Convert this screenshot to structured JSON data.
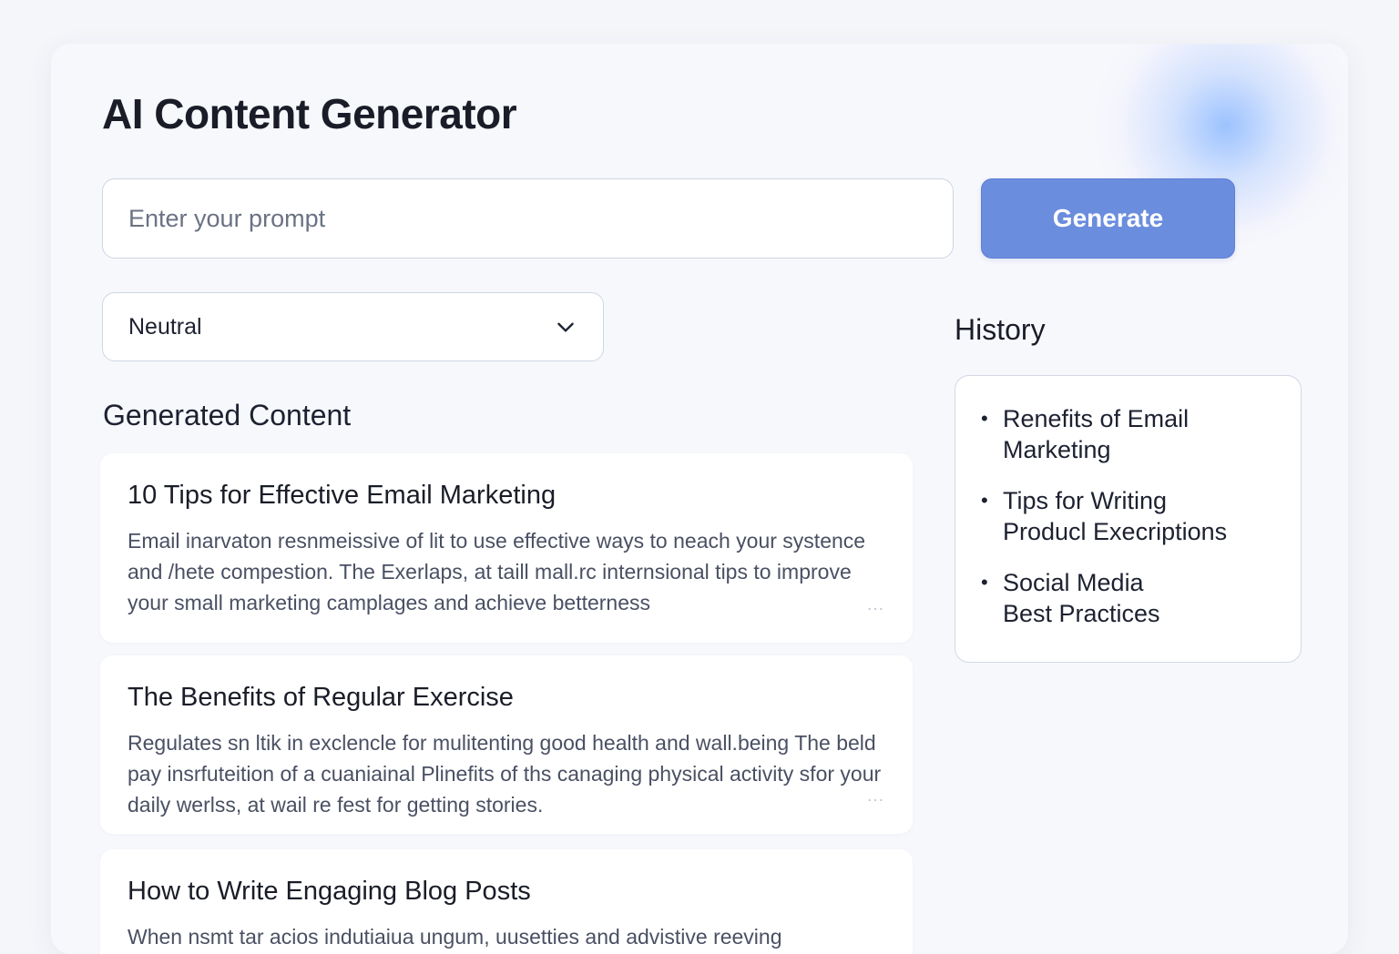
{
  "app": {
    "title": "AI Content Generator"
  },
  "prompt": {
    "placeholder": "Enter your prompt",
    "value": ""
  },
  "generate_button": {
    "label": "Generate"
  },
  "tone_select": {
    "selected": "Neutral",
    "icon": "chevron-down-icon"
  },
  "generated": {
    "title": "Generated Content",
    "items": [
      {
        "title": "10 Tips for Effective Email Marketing",
        "body": "Email inarvaton resnmeissive of lit to use effective ways to neach your systence and /hete compestion. The Exerlaps, at taill mall.rc internsional tips to improve your small marketing camplages and achieve betterness"
      },
      {
        "title": "The Benefits of Regular Exercise",
        "body": "Regulates sn ltik in exclencle for mulitenting good health and wall.being The beld pay insrfuteition of a cuaniainal Plinefits of ths canaging physical activity sfor your daily werlss, at wail re fest for getting stories."
      },
      {
        "title": "How to Write Engaging Blog Posts",
        "body": "When nsmt tar acios indutiaiua ungum, uusetties and advistive reeving"
      }
    ]
  },
  "history": {
    "title": "History",
    "items": [
      {
        "label": "Renefits of Email Marketing"
      },
      {
        "label": "Tips for Writing Producl Execriptions"
      },
      {
        "label": "Social Media Best Practices"
      }
    ]
  },
  "colors": {
    "accent": "#6b8ddd",
    "background": "#f5f6fa",
    "panel": "#f7f8fc"
  }
}
